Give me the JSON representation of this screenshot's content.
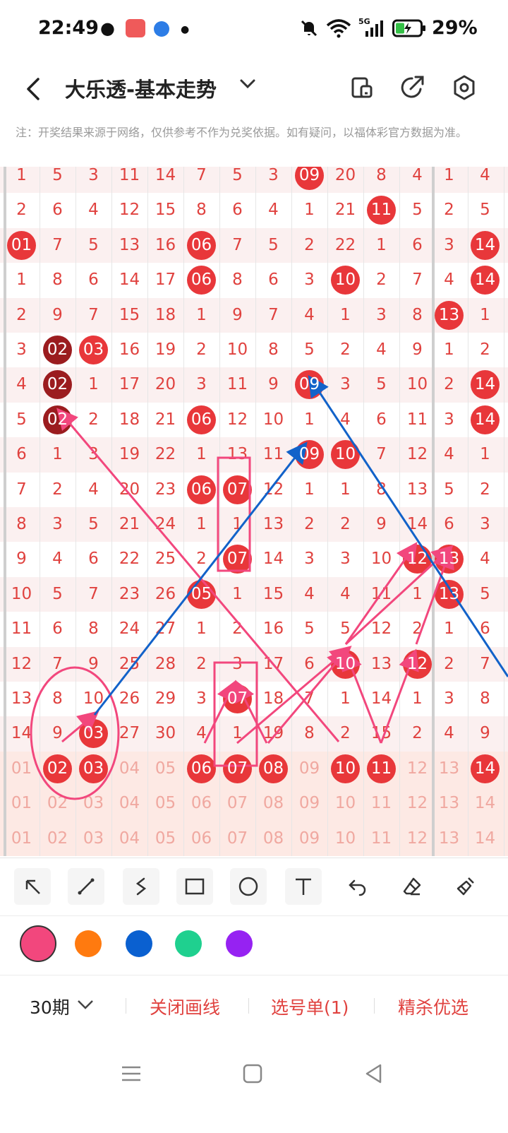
{
  "status_bar": {
    "time": "22:49",
    "battery": "29%",
    "network": "5G"
  },
  "header": {
    "title": "大乐透-基本走势"
  },
  "notice": "注：开奖结果来源于网络，仅供参考不作为兑奖依据。如有疑问，以福体彩官方数据为准。",
  "grid": {
    "rows": [
      [
        "1",
        "5",
        "3",
        "11",
        "14",
        "7",
        "5",
        "3",
        "09",
        "20",
        "8",
        "4",
        "1",
        "4"
      ],
      [
        "2",
        "6",
        "4",
        "12",
        "15",
        "8",
        "6",
        "4",
        "1",
        "21",
        "11",
        "5",
        "2",
        "5"
      ],
      [
        "01",
        "7",
        "5",
        "13",
        "16",
        "06",
        "7",
        "5",
        "2",
        "22",
        "1",
        "6",
        "3",
        "14"
      ],
      [
        "1",
        "8",
        "6",
        "14",
        "17",
        "06",
        "8",
        "6",
        "3",
        "10",
        "2",
        "7",
        "4",
        "14"
      ],
      [
        "2",
        "9",
        "7",
        "15",
        "18",
        "1",
        "9",
        "7",
        "4",
        "1",
        "3",
        "8",
        "13",
        "1"
      ],
      [
        "3",
        "02",
        "03",
        "16",
        "19",
        "2",
        "10",
        "8",
        "5",
        "2",
        "4",
        "9",
        "1",
        "2"
      ],
      [
        "4",
        "02",
        "1",
        "17",
        "20",
        "3",
        "11",
        "9",
        "09",
        "3",
        "5",
        "10",
        "2",
        "14"
      ],
      [
        "5",
        "02",
        "2",
        "18",
        "21",
        "06",
        "12",
        "10",
        "1",
        "4",
        "6",
        "11",
        "3",
        "14"
      ],
      [
        "6",
        "1",
        "3",
        "19",
        "22",
        "1",
        "13",
        "11",
        "09",
        "10",
        "7",
        "12",
        "4",
        "1"
      ],
      [
        "7",
        "2",
        "4",
        "20",
        "23",
        "06",
        "07",
        "12",
        "1",
        "1",
        "8",
        "13",
        "5",
        "2"
      ],
      [
        "8",
        "3",
        "5",
        "21",
        "24",
        "1",
        "1",
        "13",
        "2",
        "2",
        "9",
        "14",
        "6",
        "3"
      ],
      [
        "9",
        "4",
        "6",
        "22",
        "25",
        "2",
        "07",
        "14",
        "3",
        "3",
        "10",
        "12",
        "13",
        "4"
      ],
      [
        "10",
        "5",
        "7",
        "23",
        "26",
        "05",
        "1",
        "15",
        "4",
        "4",
        "11",
        "1",
        "13",
        "5"
      ],
      [
        "11",
        "6",
        "8",
        "24",
        "27",
        "1",
        "2",
        "16",
        "5",
        "5",
        "12",
        "2",
        "1",
        "6"
      ],
      [
        "12",
        "7",
        "9",
        "25",
        "28",
        "2",
        "3",
        "17",
        "6",
        "10",
        "13",
        "12",
        "2",
        "7"
      ],
      [
        "13",
        "8",
        "10",
        "26",
        "29",
        "3",
        "07",
        "18",
        "7",
        "1",
        "14",
        "1",
        "3",
        "8"
      ],
      [
        "14",
        "9",
        "03",
        "27",
        "30",
        "4",
        "1",
        "19",
        "8",
        "2",
        "15",
        "2",
        "4",
        "9"
      ],
      [
        "01",
        "02",
        "03",
        "04",
        "05",
        "06",
        "07",
        "08",
        "09",
        "10",
        "11",
        "12",
        "13",
        "14"
      ],
      [
        "01",
        "02",
        "03",
        "04",
        "05",
        "06",
        "07",
        "08",
        "09",
        "10",
        "11",
        "12",
        "13",
        "14"
      ],
      [
        "01",
        "02",
        "03",
        "04",
        "05",
        "06",
        "07",
        "08",
        "09",
        "10",
        "11",
        "12",
        "13",
        "14"
      ],
      [
        "01",
        "02",
        "03",
        "04",
        "05",
        "06",
        "07",
        "08",
        "09",
        "10",
        "11",
        "12",
        "13",
        "14"
      ]
    ],
    "balls": [
      [
        0,
        8
      ],
      [
        1,
        10
      ],
      [
        2,
        0
      ],
      [
        2,
        5
      ],
      [
        2,
        13
      ],
      [
        3,
        5
      ],
      [
        3,
        9
      ],
      [
        3,
        13
      ],
      [
        4,
        12
      ],
      [
        5,
        1
      ],
      [
        5,
        2
      ],
      [
        6,
        1
      ],
      [
        6,
        8
      ],
      [
        6,
        13
      ],
      [
        7,
        1
      ],
      [
        7,
        5
      ],
      [
        7,
        13
      ],
      [
        8,
        8
      ],
      [
        8,
        9
      ],
      [
        9,
        5
      ],
      [
        9,
        6
      ],
      [
        11,
        6
      ],
      [
        11,
        11
      ],
      [
        11,
        12
      ],
      [
        12,
        5
      ],
      [
        12,
        12
      ],
      [
        14,
        9
      ],
      [
        14,
        11
      ],
      [
        15,
        6
      ],
      [
        16,
        2
      ],
      [
        17,
        1
      ],
      [
        17,
        2
      ],
      [
        17,
        5
      ],
      [
        17,
        6
      ],
      [
        17,
        7
      ],
      [
        17,
        9
      ],
      [
        17,
        10
      ],
      [
        17,
        13
      ]
    ],
    "dark_balls": [
      [
        5,
        1
      ],
      [
        6,
        1
      ],
      [
        7,
        1
      ]
    ]
  },
  "tools": [
    "arrow-tool",
    "line-tool",
    "freehand-tool",
    "rectangle-tool",
    "circle-tool",
    "text-tool",
    "undo-tool",
    "eraser-tool",
    "clear-tool"
  ],
  "colors": {
    "swatches": [
      "#f2477d",
      "#ff7a0f",
      "#0a60d0",
      "#1fd08f",
      "#9622f2"
    ],
    "accent": "#e0423f",
    "selected": "#f2477d"
  },
  "bottom_bar": {
    "period": "30期",
    "close_lines": "关闭画线",
    "pick_list": "选号单(1)",
    "premium": "精杀优选"
  }
}
